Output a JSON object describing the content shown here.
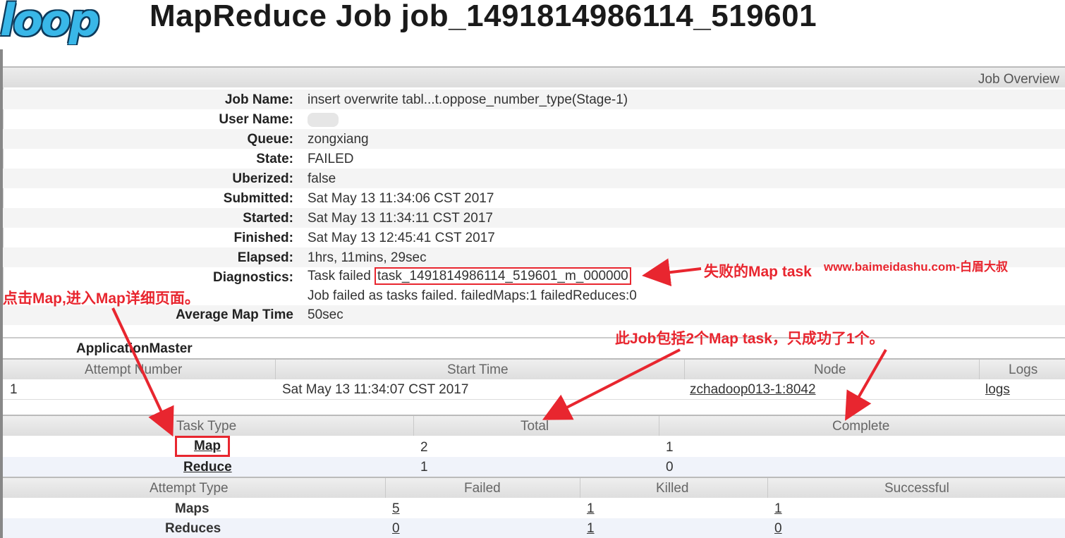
{
  "logo": {
    "text": "loop"
  },
  "page_title": "MapReduce Job job_1491814986114_519601",
  "overview": {
    "section_title": "Job Overview",
    "rows": [
      {
        "label": "Job Name:",
        "value": "insert overwrite tabl...t.oppose_number_type(Stage-1)"
      },
      {
        "label": "User Name:",
        "value": ""
      },
      {
        "label": "Queue:",
        "value": "zongxiang"
      },
      {
        "label": "State:",
        "value": "FAILED"
      },
      {
        "label": "Uberized:",
        "value": "false"
      },
      {
        "label": "Submitted:",
        "value": "Sat May 13 11:34:06 CST 2017"
      },
      {
        "label": "Started:",
        "value": "Sat May 13 11:34:11 CST 2017"
      },
      {
        "label": "Finished:",
        "value": "Sat May 13 12:45:41 CST 2017"
      },
      {
        "label": "Elapsed:",
        "value": "1hrs, 11mins, 29sec"
      }
    ],
    "diagnostics": {
      "label": "Diagnostics:",
      "prefix": "Task failed ",
      "task_id": "task_1491814986114_519601_m_000000",
      "line2": "Job failed as tasks failed. failedMaps:1 failedReduces:0"
    },
    "avg_map": {
      "label": "Average Map Time",
      "value": "50sec"
    }
  },
  "application_master": {
    "title": "ApplicationMaster",
    "headers": [
      "Attempt Number",
      "Start Time",
      "Node",
      "Logs"
    ],
    "row": {
      "attempt": "1",
      "start": "Sat May 13 11:34:07 CST 2017",
      "node": "zchadoop013-1:8042",
      "logs": "logs"
    }
  },
  "task_table": {
    "headers": [
      "Task Type",
      "Total",
      "Complete"
    ],
    "rows": [
      {
        "type": "Map",
        "total": "2",
        "complete": "1"
      },
      {
        "type": "Reduce",
        "total": "1",
        "complete": "0"
      }
    ]
  },
  "attempt_table": {
    "headers": [
      "Attempt Type",
      "Failed",
      "Killed",
      "Successful"
    ],
    "rows": [
      {
        "type": "Maps",
        "failed": "5",
        "killed": "1",
        "successful": "1"
      },
      {
        "type": "Reduces",
        "failed": "0",
        "killed": "1",
        "successful": "0"
      }
    ]
  },
  "annotations": {
    "failed_map": "失败的Map task",
    "watermark": "www.baimeidashu.com-白眉大叔",
    "click_map": "点击Map,进入Map详细页面。",
    "job_contains": "此Job包括2个Map task，只成功了1个。"
  },
  "colors": {
    "annotation_red": "#e8262f",
    "logo_blue": "#39b7e8"
  }
}
